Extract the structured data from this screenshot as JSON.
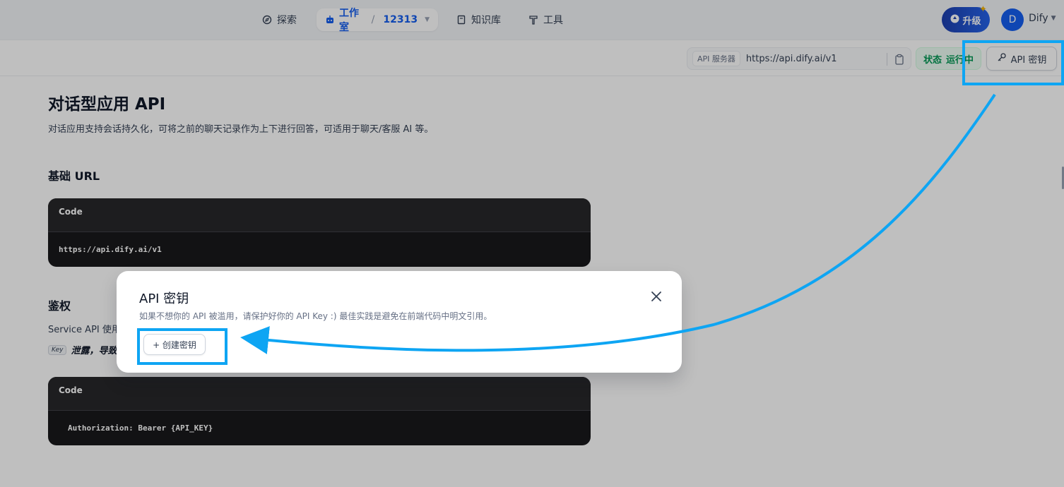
{
  "nav": {
    "explore_label": "探索",
    "studio_label": "工作室",
    "studio_separator": "/",
    "studio_app": "12313",
    "knowledge_label": "知识库",
    "tools_label": "工具",
    "upgrade_label": "升级",
    "user_initial": "D",
    "user_name": "Dify"
  },
  "toolbar": {
    "server_tag": "API 服务器",
    "server_url": "https://api.dify.ai/v1",
    "status_label": "状态",
    "status_value": "运行中",
    "api_key_button": "API 密钥"
  },
  "doc": {
    "title": "对话型应用 API",
    "description": "对话应用支持会话持久化，可将之前的聊天记录作为上下进行回答，可适用于聊天/客服 AI 等。",
    "base_url_heading": "基础 URL",
    "code1_label": "Code",
    "code1_content": "https://api.dify.ai/v1",
    "auth_heading": "鉴权",
    "auth_text_visible": "Service API 使用",
    "auth_kbd": "Key",
    "auth_warning_visible": "泄露，导致",
    "code2_label": "Code",
    "code2_content": "Authorization: Bearer {API_KEY}"
  },
  "modal": {
    "title": "API 密钥",
    "description": "如果不想你的 API 被滥用，请保护好你的 API Key :) 最佳实践是避免在前端代码中明文引用。",
    "create_button": "+ 创建密钥"
  },
  "colors": {
    "accent": "#155eef",
    "status_green": "#039855",
    "highlight": "#0ea5f3",
    "code_bg": "#18181b"
  }
}
